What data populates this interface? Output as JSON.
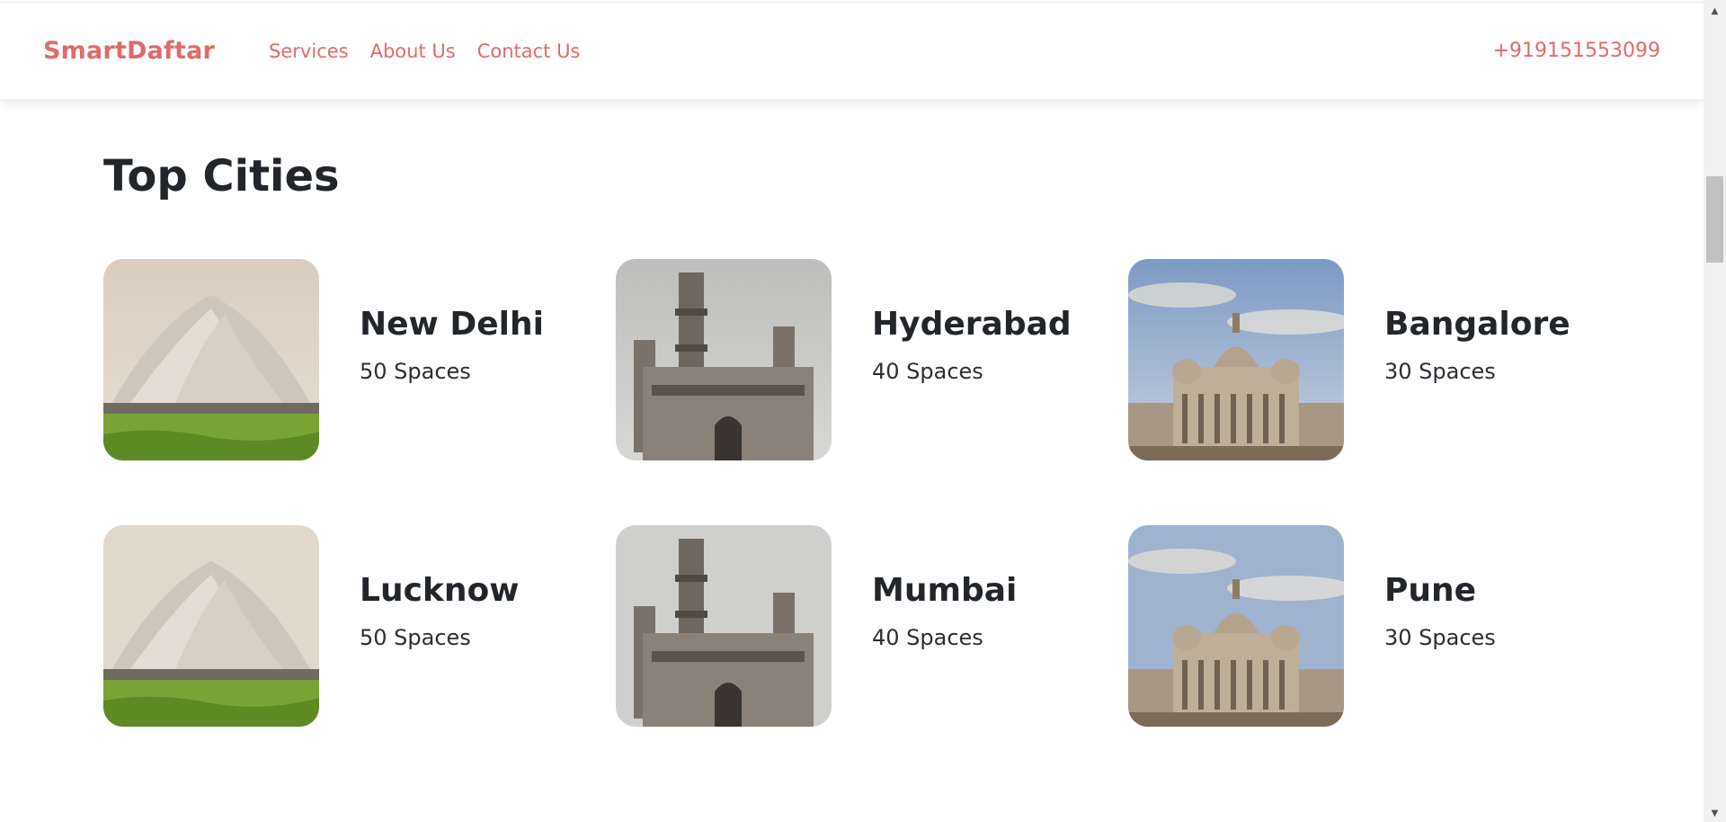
{
  "header": {
    "brand": "SmartDaftar",
    "nav": [
      "Services",
      "About Us",
      "Contact Us"
    ],
    "phone": "+919151553099"
  },
  "section": {
    "title": "Top Cities"
  },
  "cities": [
    {
      "name": "New Delhi",
      "spaces": "50 Spaces",
      "image": "lotus-temple"
    },
    {
      "name": "Hyderabad",
      "spaces": "40 Spaces",
      "image": "charminar"
    },
    {
      "name": "Bangalore",
      "spaces": "30 Spaces",
      "image": "vidhana-soudha"
    },
    {
      "name": "Lucknow",
      "spaces": "50 Spaces",
      "image": "lotus-temple"
    },
    {
      "name": "Mumbai",
      "spaces": "40 Spaces",
      "image": "charminar"
    },
    {
      "name": "Pune",
      "spaces": "30 Spaces",
      "image": "vidhana-soudha"
    }
  ],
  "colors": {
    "accent": "#e06b6b",
    "heading": "#22262a"
  }
}
